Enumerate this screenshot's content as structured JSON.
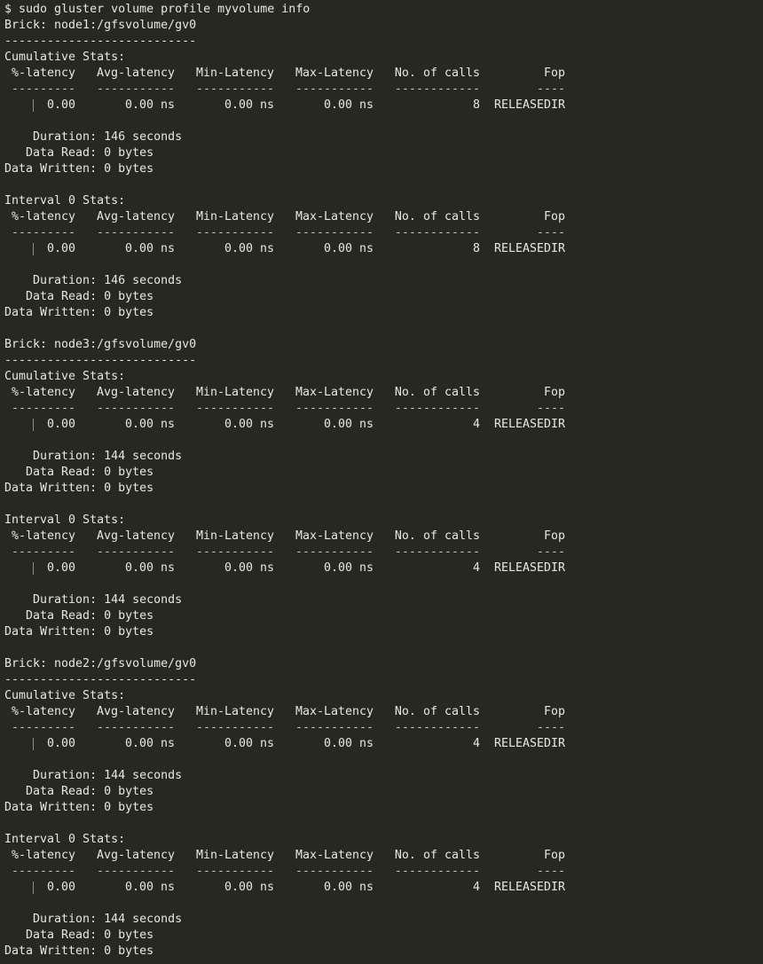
{
  "command": "$ sudo gluster volume profile myvolume info",
  "headers": {
    "pct": "%-latency",
    "avg": "Avg-latency",
    "min": "Min-Latency",
    "max": "Max-Latency",
    "calls": "No. of calls",
    "fop": "Fop"
  },
  "underlines": {
    "pct": "---------",
    "avg": "-----------",
    "min": "-----------",
    "max": "-----------",
    "calls": "------------",
    "fop": "----"
  },
  "bricks": [
    {
      "title": "Brick: node1:/gfsvolume/gv0",
      "separator": "---------------------------",
      "sections": [
        {
          "title": "Cumulative Stats:",
          "row": {
            "pct": "0.00",
            "avg": "0.00 ns",
            "min": "0.00 ns",
            "max": "0.00 ns",
            "calls": "8",
            "fop": "RELEASEDIR"
          },
          "duration": "    Duration: 146 seconds",
          "read": "   Data Read: 0 bytes",
          "written": "Data Written: 0 bytes"
        },
        {
          "title": "Interval 0 Stats:",
          "row": {
            "pct": "0.00",
            "avg": "0.00 ns",
            "min": "0.00 ns",
            "max": "0.00 ns",
            "calls": "8",
            "fop": "RELEASEDIR"
          },
          "duration": "    Duration: 146 seconds",
          "read": "   Data Read: 0 bytes",
          "written": "Data Written: 0 bytes"
        }
      ]
    },
    {
      "title": "Brick: node3:/gfsvolume/gv0",
      "separator": "---------------------------",
      "sections": [
        {
          "title": "Cumulative Stats:",
          "row": {
            "pct": "0.00",
            "avg": "0.00 ns",
            "min": "0.00 ns",
            "max": "0.00 ns",
            "calls": "4",
            "fop": "RELEASEDIR"
          },
          "duration": "    Duration: 144 seconds",
          "read": "   Data Read: 0 bytes",
          "written": "Data Written: 0 bytes"
        },
        {
          "title": "Interval 0 Stats:",
          "row": {
            "pct": "0.00",
            "avg": "0.00 ns",
            "min": "0.00 ns",
            "max": "0.00 ns",
            "calls": "4",
            "fop": "RELEASEDIR"
          },
          "duration": "    Duration: 144 seconds",
          "read": "   Data Read: 0 bytes",
          "written": "Data Written: 0 bytes"
        }
      ]
    },
    {
      "title": "Brick: node2:/gfsvolume/gv0",
      "separator": "---------------------------",
      "sections": [
        {
          "title": "Cumulative Stats:",
          "row": {
            "pct": "0.00",
            "avg": "0.00 ns",
            "min": "0.00 ns",
            "max": "0.00 ns",
            "calls": "4",
            "fop": "RELEASEDIR"
          },
          "duration": "    Duration: 144 seconds",
          "read": "   Data Read: 0 bytes",
          "written": "Data Written: 0 bytes"
        },
        {
          "title": "Interval 0 Stats:",
          "row": {
            "pct": "0.00",
            "avg": "0.00 ns",
            "min": "0.00 ns",
            "max": "0.00 ns",
            "calls": "4",
            "fop": "RELEASEDIR"
          },
          "duration": "    Duration: 144 seconds",
          "read": "   Data Read: 0 bytes",
          "written": "Data Written: 0 bytes"
        }
      ]
    }
  ]
}
